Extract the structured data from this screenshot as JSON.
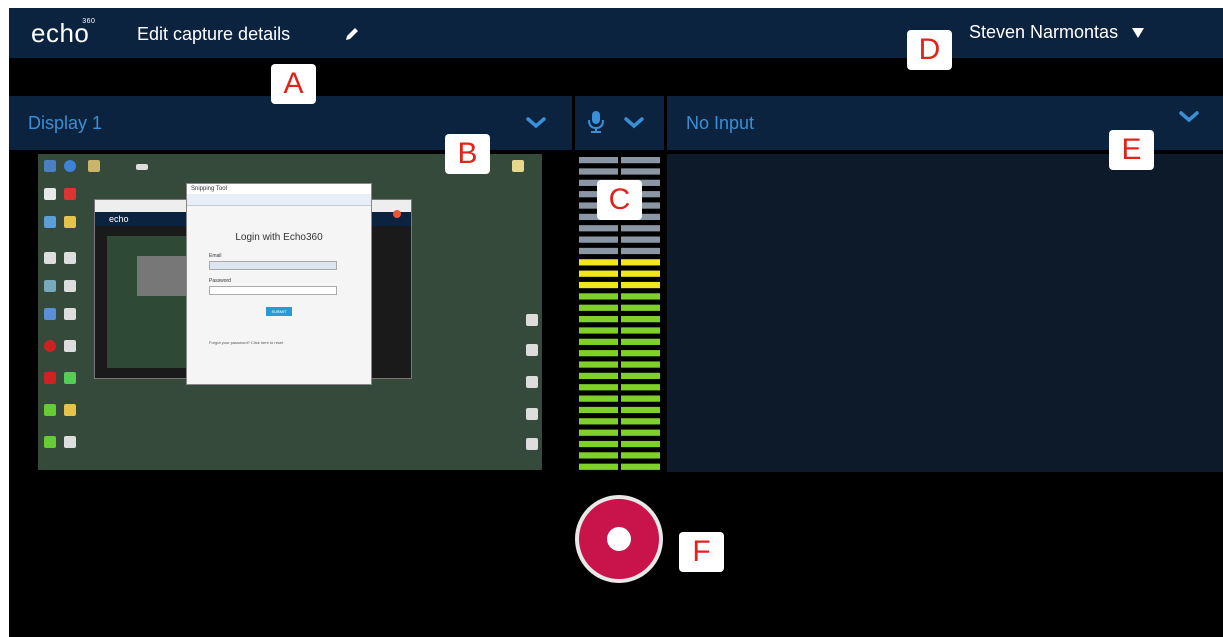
{
  "topbar": {
    "logo": "echo",
    "logo_sup": "360",
    "capture_title": "Edit capture details",
    "user_name": "Steven Narmontas"
  },
  "display_panel": {
    "label": "Display 1"
  },
  "input_panel": {
    "label": "No Input"
  },
  "preview": {
    "login_title": "Login with Echo360",
    "email_label": "Email",
    "password_label": "Password",
    "submit_label": "SUBMIT",
    "forgot_text": "Forgot your password? Click here to reset",
    "app_title": "echo",
    "snipping_title": "Snipping Tool"
  },
  "callouts": {
    "a": "A",
    "b": "B",
    "c": "C",
    "d": "D",
    "e": "E",
    "f": "F"
  },
  "colors": {
    "topbar": "#0c2340",
    "accent_blue": "#3a8fd6",
    "record": "#c8134b",
    "callout_letter": "#e2231a"
  },
  "audio_meter": {
    "segments_total": 28,
    "green_segments": 16,
    "yellow_segments": 3
  }
}
